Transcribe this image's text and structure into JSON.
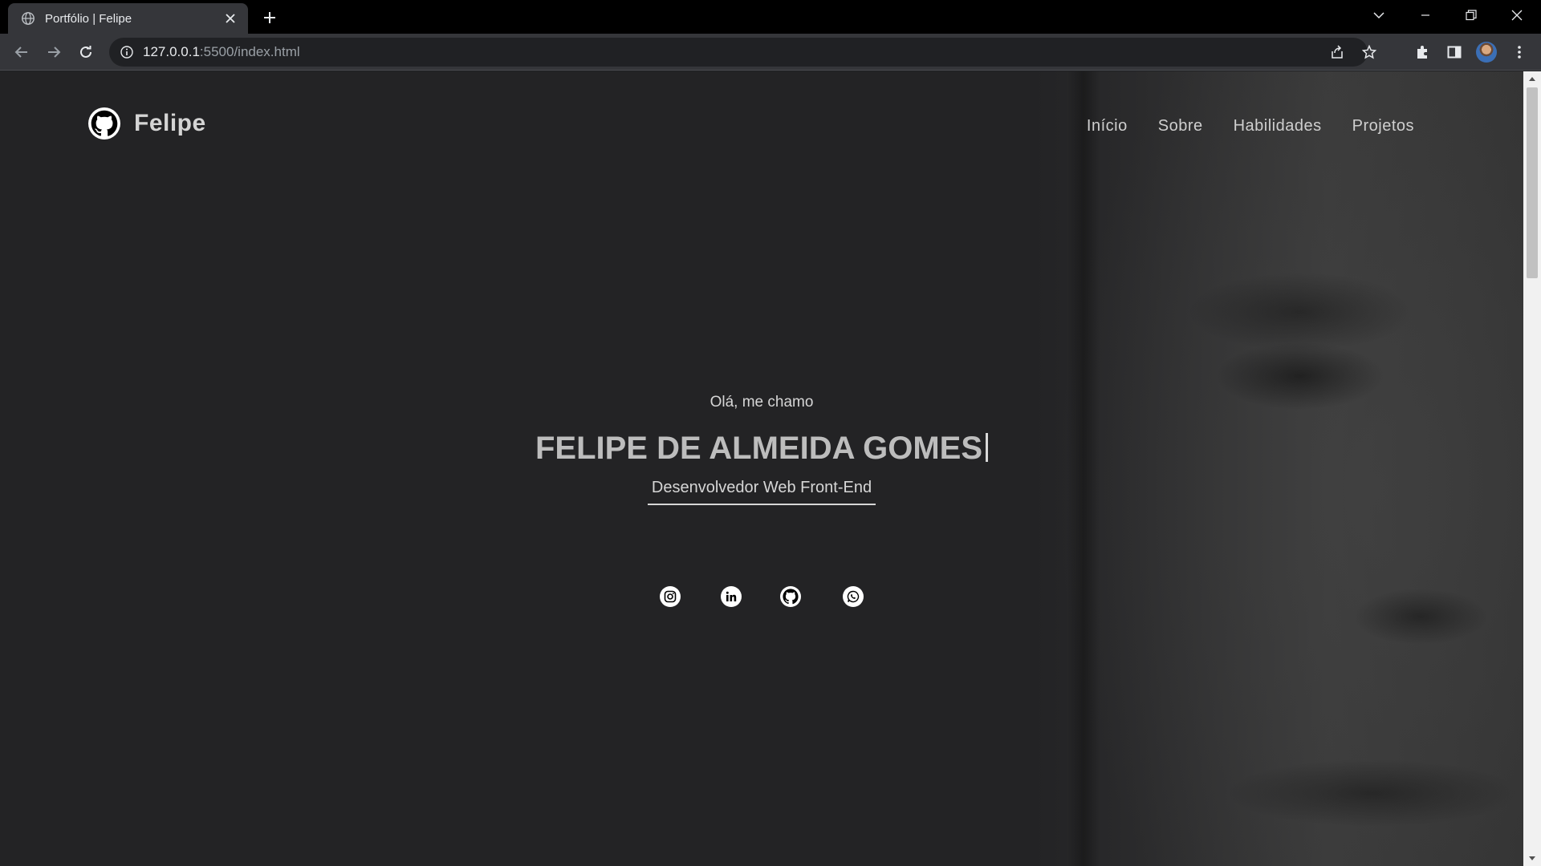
{
  "browser": {
    "tab_title": "Portfólio | Felipe",
    "tab_close_icon": "close-icon",
    "new_tab_icon": "plus-icon",
    "url_host": "127.0.0.1",
    "url_path": ":5500/index.html",
    "icons": [
      "back-arrow-icon",
      "forward-arrow-icon",
      "reload-icon",
      "info-icon",
      "share-icon",
      "star-icon",
      "extensions-icon",
      "side-panel-icon",
      "profile-avatar",
      "more-menu-icon"
    ],
    "window_controls": [
      "tab-search-icon",
      "minimize-icon",
      "restore-icon",
      "close-window-icon"
    ]
  },
  "site": {
    "brand": "Felipe",
    "nav": [
      "Início",
      "Sobre",
      "Habilidades",
      "Projetos"
    ]
  },
  "hero": {
    "greeting": "Olá, me chamo",
    "name": "FELIPE DE ALMEIDA GOMES",
    "role": "Desenvolvedor Web Front-End",
    "socials": [
      "instagram-icon",
      "linkedin-icon",
      "github-icon",
      "whatsapp-icon"
    ]
  },
  "colors": {
    "page_background": "#232325",
    "text": "#d6d6d6",
    "browser_frame": "#000000",
    "toolbar": "#35363a"
  }
}
